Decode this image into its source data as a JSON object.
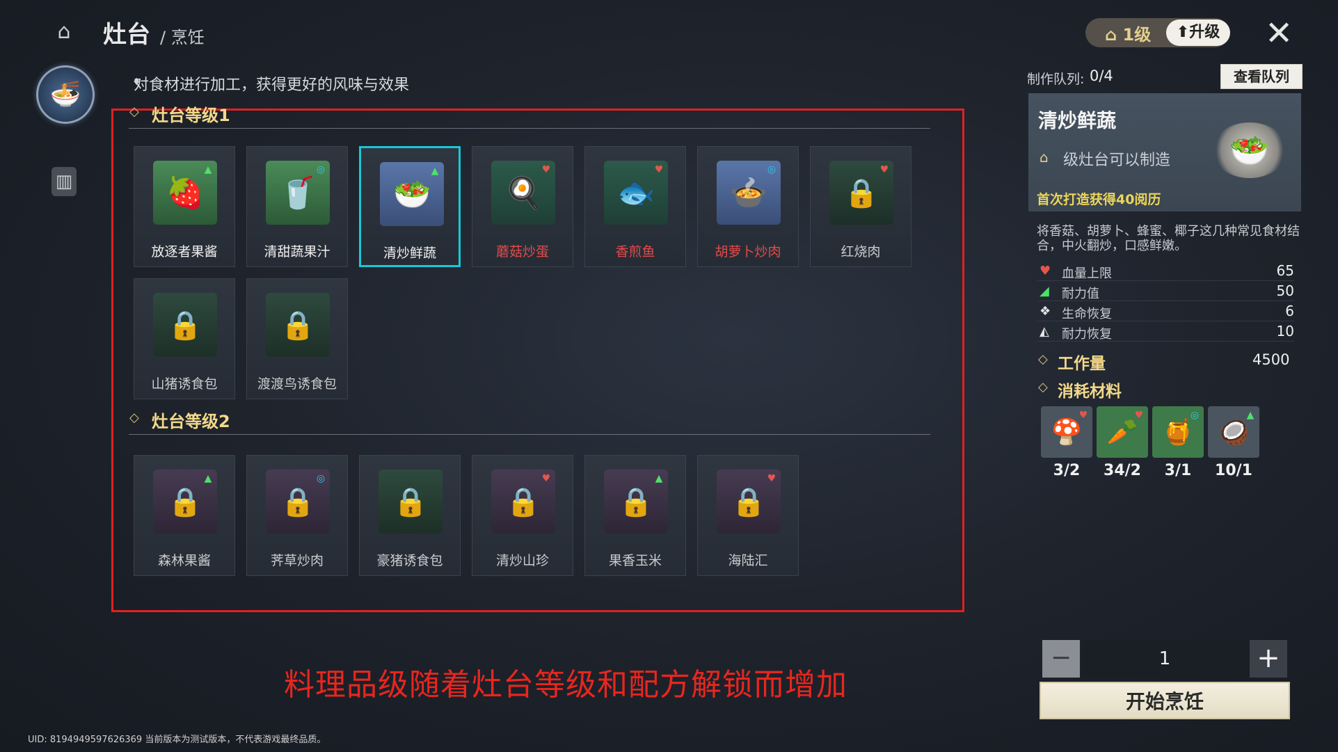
{
  "header": {
    "title": "灶台",
    "subtitle": "/ 烹饪"
  },
  "hint": "对食材进行加工，获得更好的风味与效果",
  "sections": [
    {
      "title": "灶台等级1",
      "items": [
        {
          "name": "放逐者果酱",
          "icon": "🍓",
          "bg": "green",
          "badge": "▲",
          "badge_type": "tri",
          "color": "normal",
          "locked": false,
          "selected": false
        },
        {
          "name": "清甜蔬果汁",
          "icon": "🥤",
          "bg": "green",
          "badge": "◎",
          "badge_type": "ring",
          "color": "normal",
          "locked": false,
          "selected": false
        },
        {
          "name": "清炒鲜蔬",
          "icon": "🥗",
          "bg": "blue",
          "badge": "▲",
          "badge_type": "tri",
          "color": "normal",
          "locked": false,
          "selected": true
        },
        {
          "name": "蘑菇炒蛋",
          "icon": "🍳",
          "bg": "teal",
          "badge": "♥",
          "badge_type": "heart",
          "color": "red",
          "locked": false,
          "selected": false
        },
        {
          "name": "香煎鱼",
          "icon": "🐟",
          "bg": "teal",
          "badge": "♥",
          "badge_type": "heart",
          "color": "red",
          "locked": false,
          "selected": false
        },
        {
          "name": "胡萝卜炒肉",
          "icon": "🍲",
          "bg": "blue",
          "badge": "◎",
          "badge_type": "ring",
          "color": "red",
          "locked": false,
          "selected": false
        },
        {
          "name": "红烧肉",
          "icon": "🔒",
          "bg": "dark",
          "badge": "♥",
          "badge_type": "heart",
          "color": "dim",
          "locked": true,
          "selected": false
        },
        {
          "name": "山猪诱食包",
          "icon": "🔒",
          "bg": "dark",
          "badge": "",
          "badge_type": "",
          "color": "dim",
          "locked": true,
          "selected": false
        },
        {
          "name": "渡渡鸟诱食包",
          "icon": "🔒",
          "bg": "dark",
          "badge": "",
          "badge_type": "",
          "color": "dim",
          "locked": true,
          "selected": false
        }
      ]
    },
    {
      "title": "灶台等级2",
      "items": [
        {
          "name": "森林果酱",
          "icon": "🔒",
          "bg": "purp",
          "badge": "▲",
          "badge_type": "tri",
          "color": "dim",
          "locked": true,
          "selected": false
        },
        {
          "name": "荠草炒肉",
          "icon": "🔒",
          "bg": "purp",
          "badge": "◎",
          "badge_type": "ring",
          "color": "dim",
          "locked": true,
          "selected": false
        },
        {
          "name": "豪猪诱食包",
          "icon": "🔒",
          "bg": "dark",
          "badge": "",
          "badge_type": "",
          "color": "dim",
          "locked": true,
          "selected": false
        },
        {
          "name": "清炒山珍",
          "icon": "🔒",
          "bg": "purp",
          "badge": "♥",
          "badge_type": "heart",
          "color": "dim",
          "locked": true,
          "selected": false
        },
        {
          "name": "果香玉米",
          "icon": "🔒",
          "bg": "purp",
          "badge": "▲",
          "badge_type": "tri",
          "color": "dim",
          "locked": true,
          "selected": false
        },
        {
          "name": "海陆汇",
          "icon": "🔒",
          "bg": "purp",
          "badge": "♥",
          "badge_type": "heart",
          "color": "dim",
          "locked": true,
          "selected": false
        }
      ]
    }
  ],
  "caption": "料理品级随着灶台等级和配方解锁而增加",
  "uid": "UID: 8194949597626369 当前版本为测试版本，不代表游戏最终品质。",
  "level": {
    "text": "1级",
    "upgrade_label": "升级"
  },
  "queue": {
    "label": "制作队列:",
    "value": "0/4",
    "view_label": "查看队列"
  },
  "detail": {
    "name": "清炒鲜蔬",
    "requirement": "级灶台可以制造",
    "first_craft": "首次打造获得40阅历",
    "description": "将香菇、胡萝卜、蜂蜜、椰子这几种常见食材结合，中火翻炒，口感鲜嫩。",
    "stats": [
      {
        "label": "血量上限",
        "value": "65",
        "icon": "♥",
        "color": "#e2574c"
      },
      {
        "label": "耐力值",
        "value": "50",
        "icon": "◢",
        "color": "#4ee06b"
      },
      {
        "label": "生命恢复",
        "value": "6",
        "icon": "❖",
        "color": "#e6e6e6"
      },
      {
        "label": "耐力恢复",
        "value": "10",
        "icon": "◭",
        "color": "#e6e6e6"
      }
    ],
    "work_label": "工作量",
    "work_value": "4500",
    "materials_label": "消耗材料",
    "materials": [
      {
        "icon": "🍄",
        "count": "3/2",
        "bg": "#4a5560",
        "badge": "♥",
        "badge_type": "heart"
      },
      {
        "icon": "🥕",
        "count": "34/2",
        "bg": "#3f7a4a",
        "badge": "♥",
        "badge_type": "heart"
      },
      {
        "icon": "🍯",
        "count": "3/1",
        "bg": "#3f7a4a",
        "badge": "◎",
        "badge_type": "ring"
      },
      {
        "icon": "🥥",
        "count": "10/1",
        "bg": "#4a5560",
        "badge": "▲",
        "badge_type": "tri"
      }
    ]
  },
  "stepper": {
    "minus": "−",
    "value": "1",
    "plus": "+"
  },
  "start_label": "开始烹饪"
}
